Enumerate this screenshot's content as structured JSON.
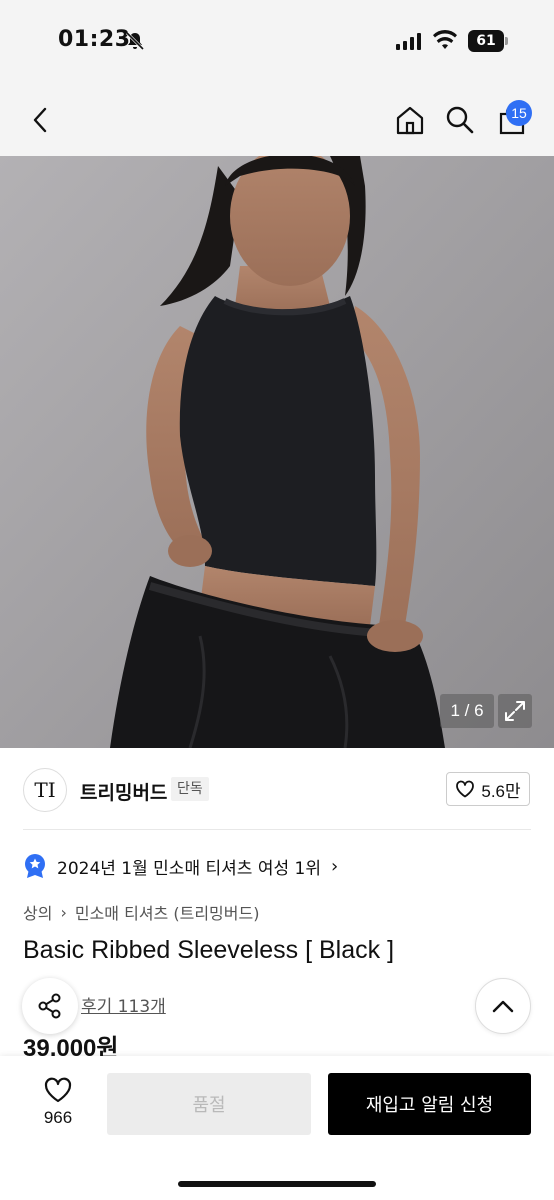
{
  "status_bar": {
    "time": "01:23",
    "battery": "61",
    "icons": [
      "bell-muted-icon",
      "cellular-signal-icon",
      "wifi-icon",
      "battery-icon"
    ]
  },
  "nav": {
    "icons": [
      "back-chevron-icon",
      "home-icon",
      "search-icon",
      "shopping-bag-icon"
    ],
    "cart_count": "15"
  },
  "gallery": {
    "counter": "1 / 6",
    "icons": [
      "expand-arrows-icon"
    ]
  },
  "brand": {
    "logo_text": "TI",
    "name": "트리밍버드",
    "tag": "단독",
    "likes": "5.6만"
  },
  "ranking": {
    "text": "2024년 1월 민소매 티셔츠 여성 1위",
    "chevron": "›"
  },
  "breadcrumb": {
    "level1": "상의",
    "separator": "›",
    "level2": "민소매 티셔츠 (트리밍버드)"
  },
  "product": {
    "title": "Basic Ribbed Sleeveless [ Black ]",
    "review_link": "후기 113개",
    "price": "39,000원"
  },
  "bottom_bar": {
    "wish_count": "966",
    "soldout_label": "품절",
    "restock_label": "재입고 알림 신청"
  },
  "colors": {
    "accent_badge": "#2f6ff4",
    "primary_button": "#000000",
    "disabled_button": "#ececec"
  }
}
